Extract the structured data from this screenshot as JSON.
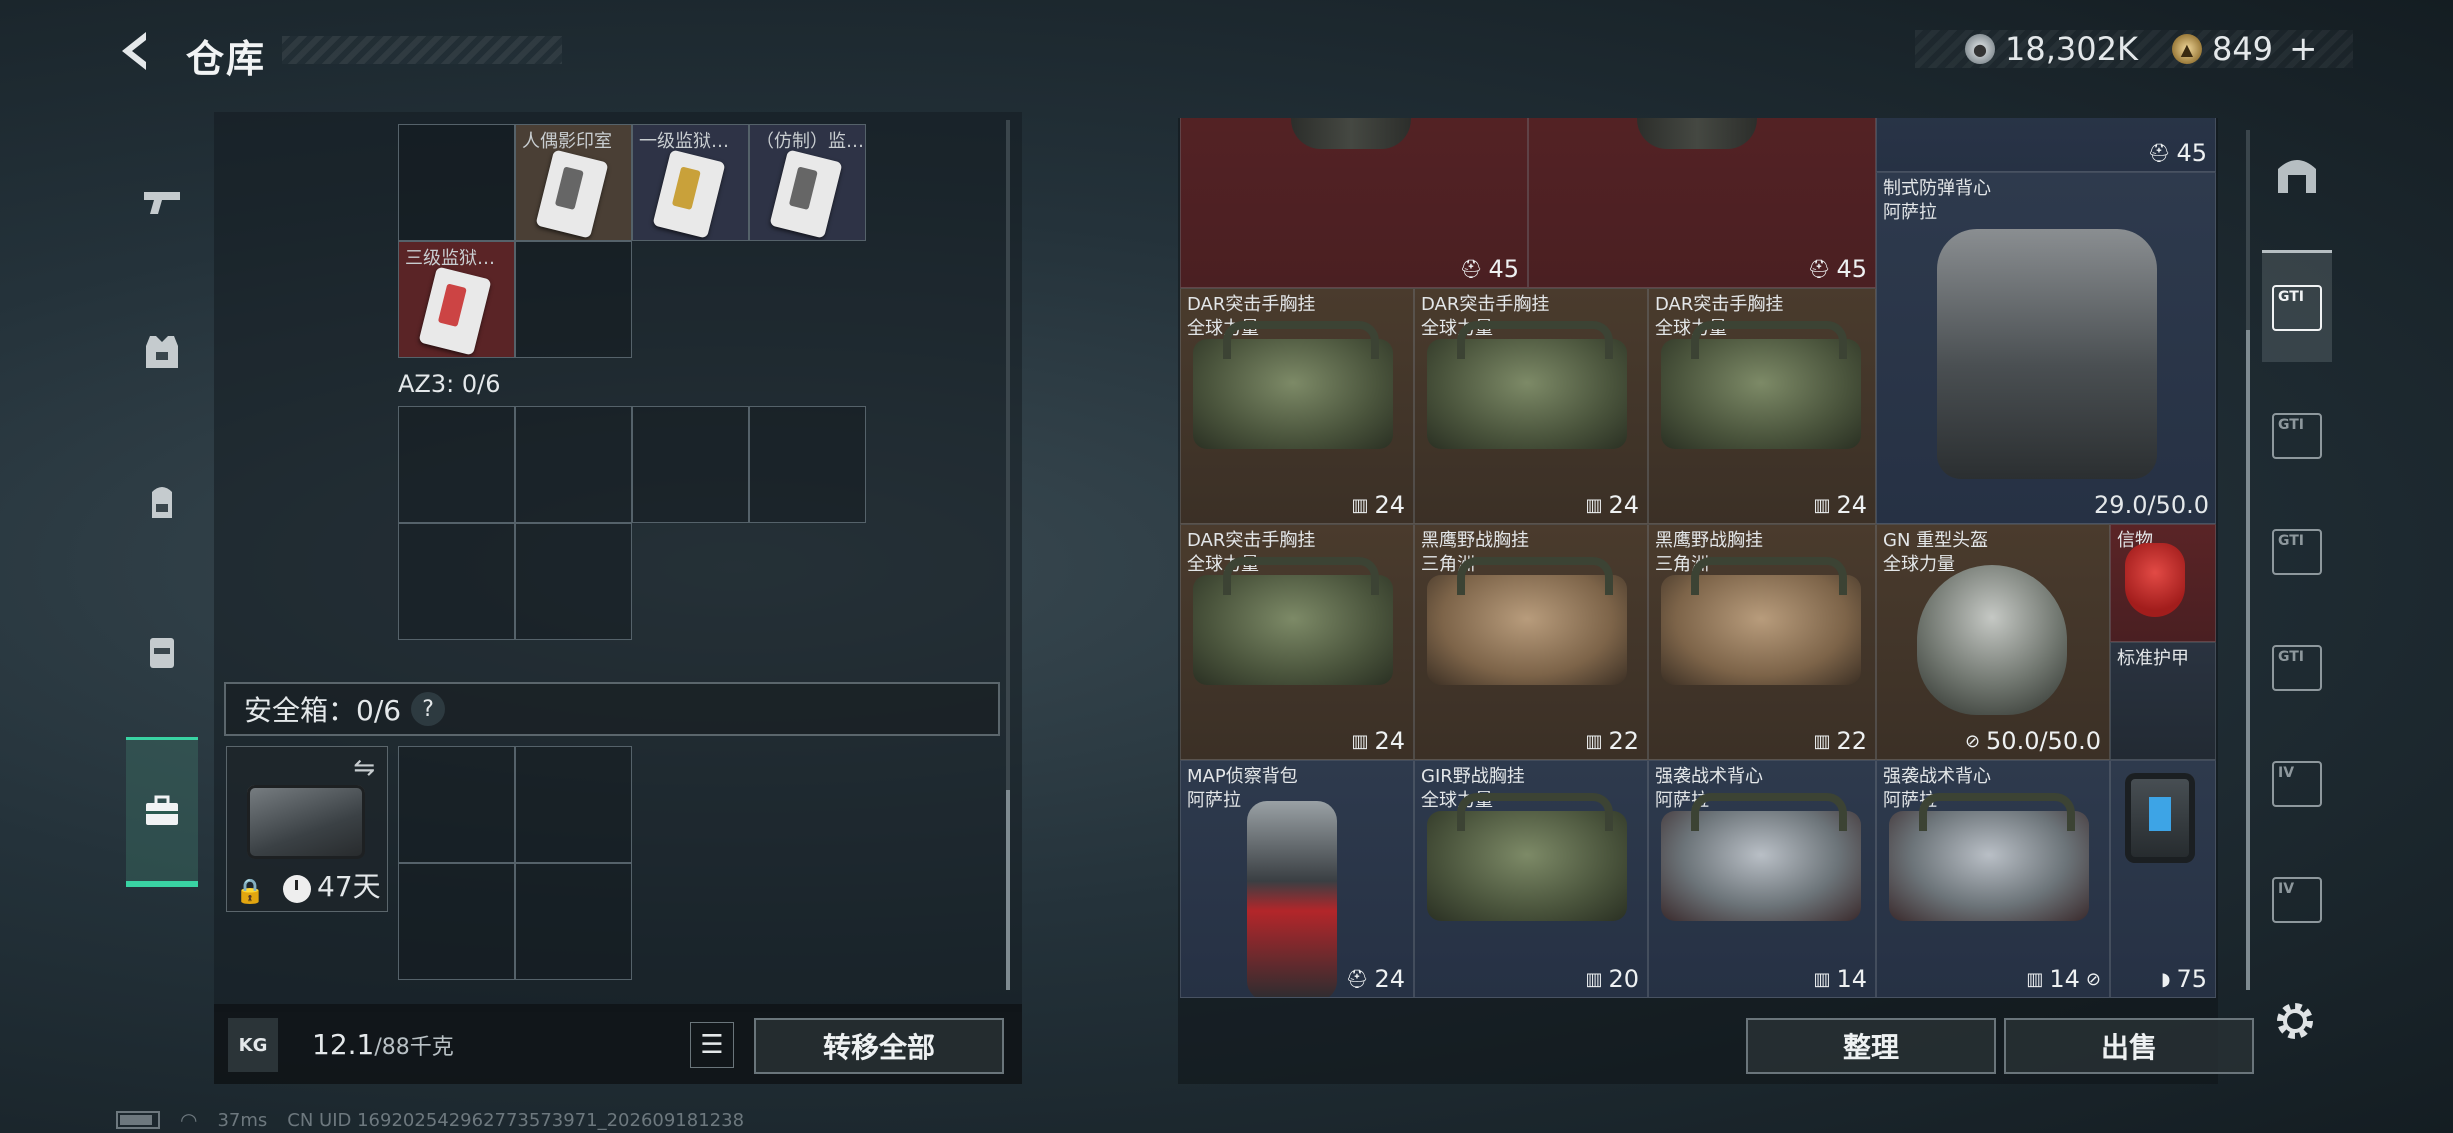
{
  "header": {
    "title": "仓库",
    "currency": [
      {
        "icon": "silver-coin-icon",
        "amount": "18,302K"
      },
      {
        "icon": "gold-coin-icon",
        "amount": "849"
      }
    ],
    "plus": "+"
  },
  "backpack": {
    "keycards": [
      {
        "label": "人偶影印室",
        "color": "silver"
      },
      {
        "label": "一级监狱…",
        "color": "gold"
      },
      {
        "label": "（仿制）监…",
        "color": "silver"
      },
      {
        "label": "三级监狱…",
        "color": "red"
      }
    ],
    "az3_label": "AZ3: 0/6",
    "safe_label": "安全箱：0/6",
    "safe_help": "?",
    "safebox_days": "47天",
    "weight_icon": "KG",
    "weight_current": "12.1",
    "weight_max": "/88千克",
    "transfer_all": "转移全部"
  },
  "stash": {
    "items": [
      {
        "name": "",
        "count": "",
        "style": "red"
      },
      {
        "name": "",
        "count": "45",
        "style": "red"
      },
      {
        "name": "",
        "count": "45",
        "style": "red"
      },
      {
        "name": "",
        "count": "45",
        "style": "blue"
      },
      {
        "name": "制式防弹背心\n阿萨拉",
        "count": "29.0/50.0",
        "style": "blue"
      },
      {
        "name": "DAR突击手胸挂\n全球力量",
        "count": "24",
        "style": "brown"
      },
      {
        "name": "DAR突击手胸挂\n全球力量",
        "count": "24",
        "style": "brown"
      },
      {
        "name": "DAR突击手胸挂\n全球力量",
        "count": "24",
        "style": "brown"
      },
      {
        "name": "DAR突击手胸挂\n全球力量",
        "count": "24",
        "style": "brown"
      },
      {
        "name": "黑鹰野战胸挂\n三角洲",
        "count": "22",
        "style": "brown"
      },
      {
        "name": "黑鹰野战胸挂\n三角洲",
        "count": "22",
        "style": "brown"
      },
      {
        "name": "GN 重型头盔\n全球力量",
        "count": "50.0/50.0",
        "style": "brown"
      },
      {
        "name": "信物",
        "count": "",
        "style": "red"
      },
      {
        "name": "标准护甲",
        "count": "",
        "style": "dark"
      },
      {
        "name": "MAP侦察背包\n阿萨拉",
        "count": "24",
        "style": "blue"
      },
      {
        "name": "GIR野战胸挂\n全球力量",
        "count": "20",
        "style": "blue"
      },
      {
        "name": "强袭战术背心\n阿萨拉",
        "count": "14",
        "style": "blue"
      },
      {
        "name": "强袭战术背心\n阿萨拉",
        "count": "14",
        "style": "blue"
      },
      {
        "name": "",
        "count": "75",
        "style": "blue"
      }
    ],
    "sort": "整理",
    "sell": "出售"
  },
  "right_tabs": [
    "",
    "GTI",
    "GTI",
    "GTI",
    "GTI",
    "IV",
    "IV"
  ],
  "status": {
    "ping": "37ms",
    "uid": "CN UID 169202542962773573971_202609181238"
  }
}
